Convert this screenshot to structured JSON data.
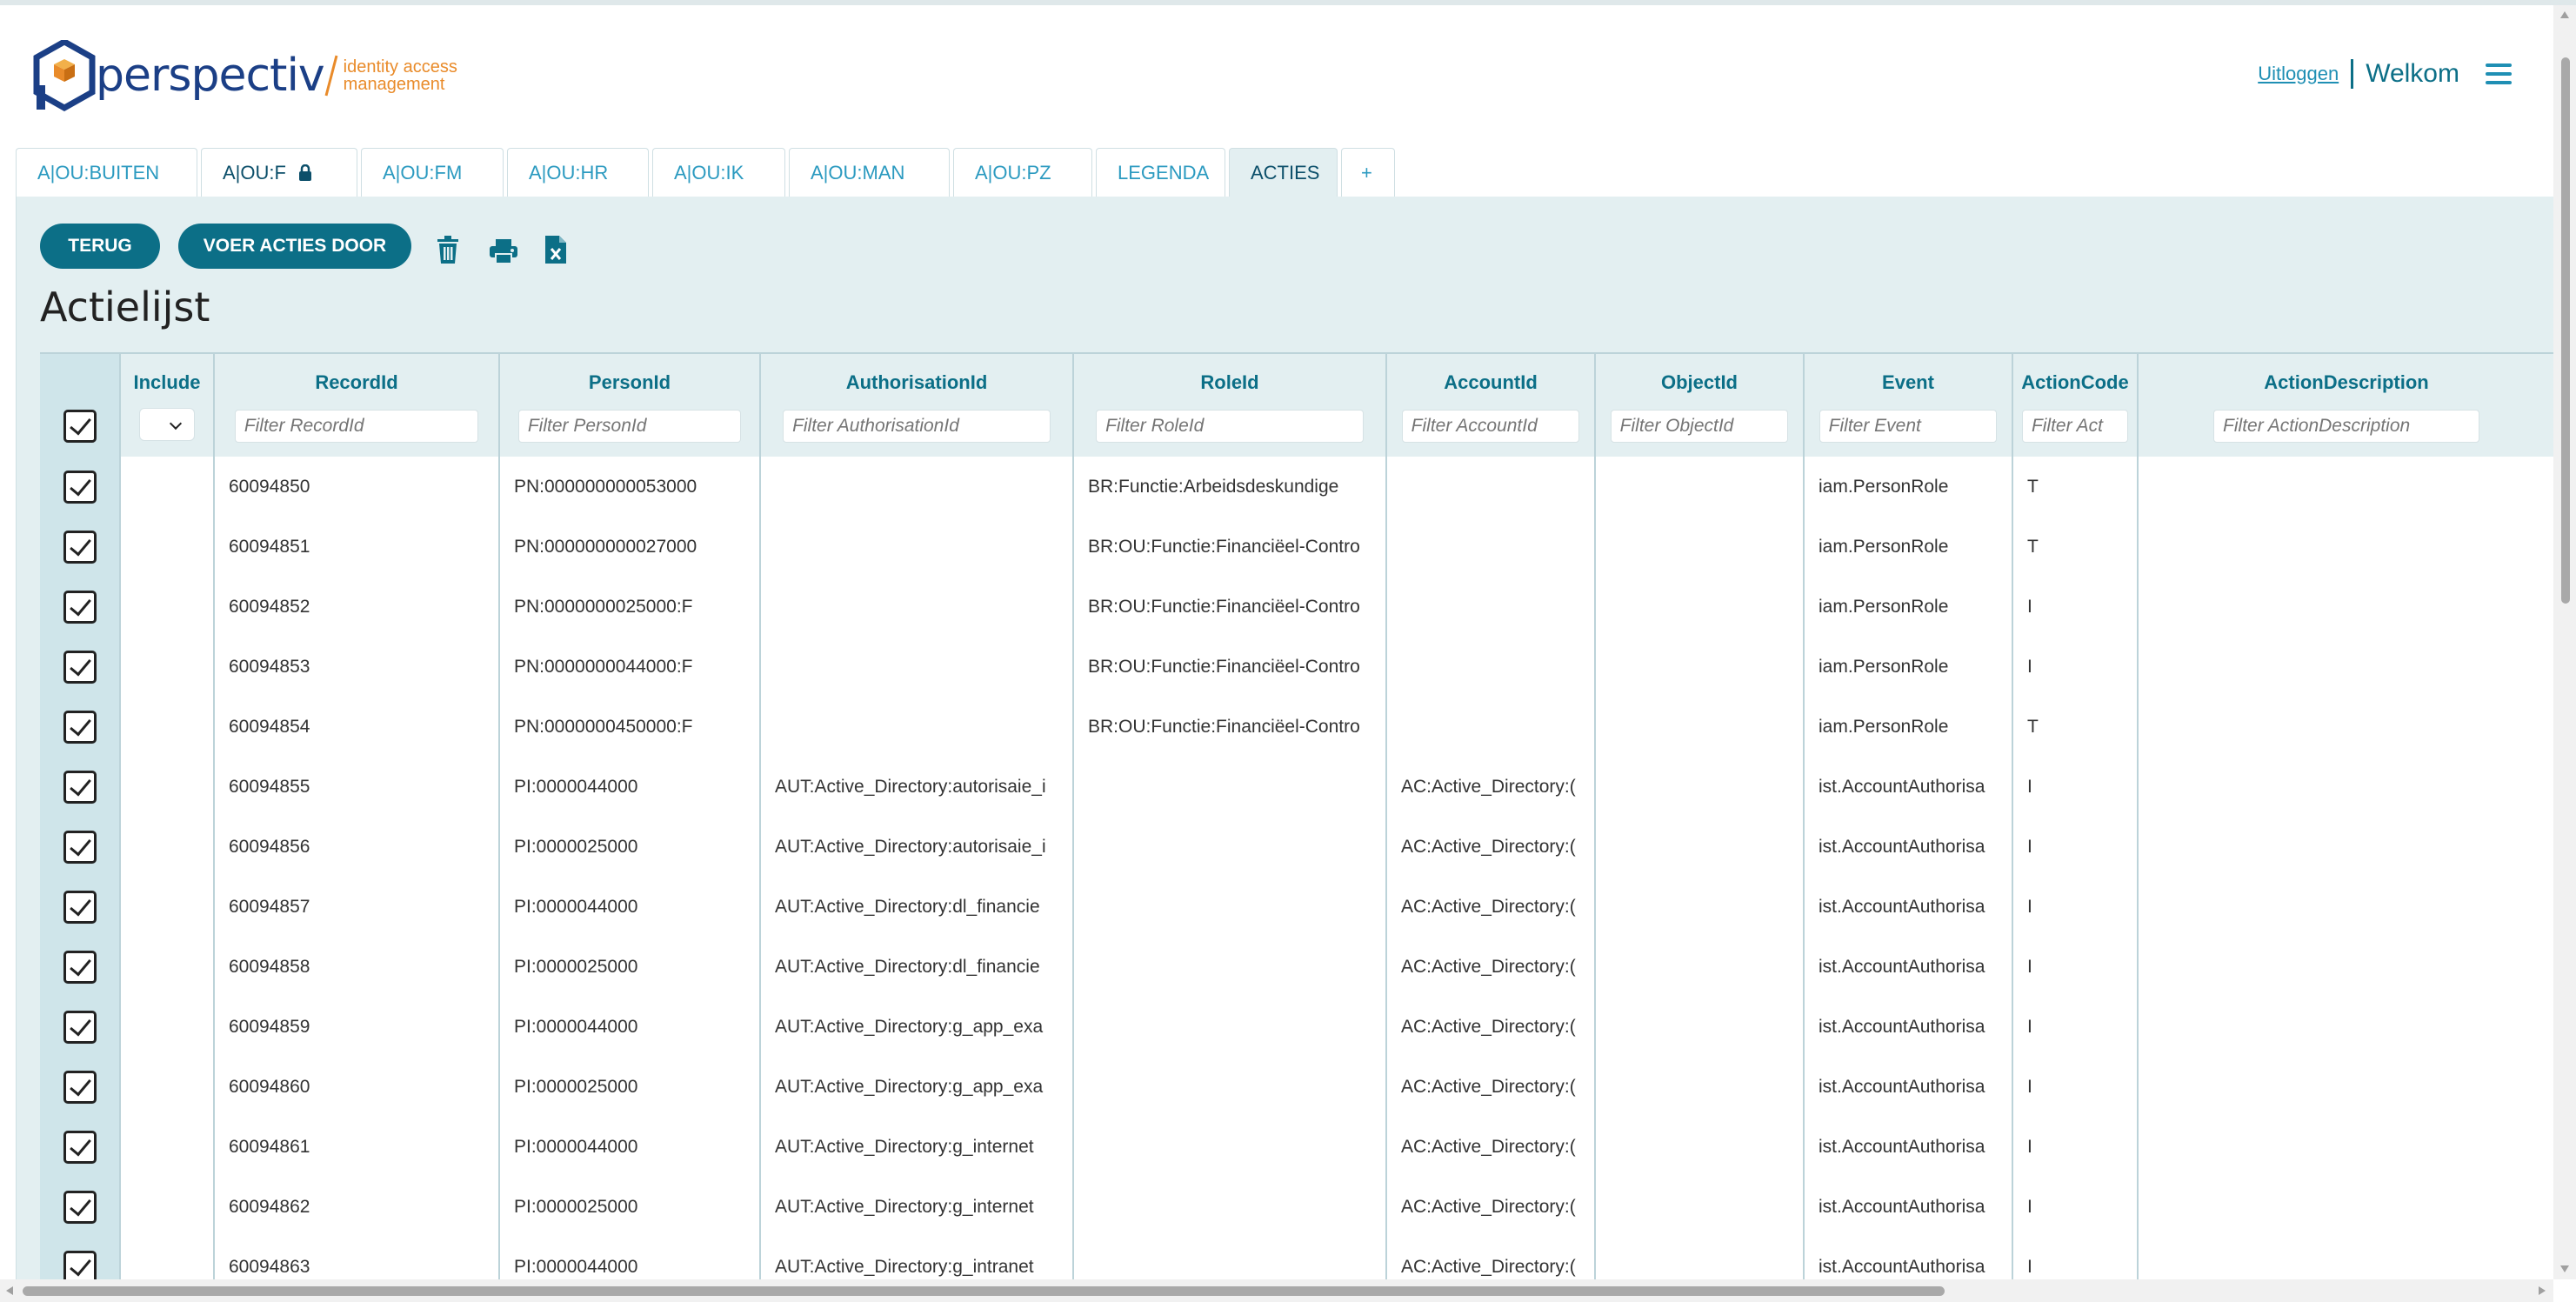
{
  "header": {
    "logo_text": "perspectiv",
    "logo_sub_line1": "identity access",
    "logo_sub_line2": "management",
    "logout_label": "Uitloggen",
    "welcome_label": "Welkom",
    "menu_icon": "hamburger-menu-icon"
  },
  "tabs": [
    {
      "label": "A|OU:BUITEN",
      "active": false
    },
    {
      "label": "A|OU:F",
      "active": true,
      "icon": "lock-icon"
    },
    {
      "label": "A|OU:FM",
      "active": false
    },
    {
      "label": "A|OU:HR",
      "active": false
    },
    {
      "label": "A|OU:IK",
      "active": false
    },
    {
      "label": "A|OU:MAN",
      "active": false
    },
    {
      "label": "A|OU:PZ",
      "active": false
    },
    {
      "label": "LEGENDA",
      "active": false
    },
    {
      "label": "ACTIES",
      "active": true
    },
    {
      "label": "+",
      "active": false
    }
  ],
  "toolbar": {
    "back_label": "TERUG",
    "execute_label": "VOER ACTIES DOOR",
    "icons": [
      "trash-icon",
      "print-icon",
      "excel-export-icon"
    ]
  },
  "page_title": "Actielijst",
  "table": {
    "columns": [
      {
        "label": "Include"
      },
      {
        "label": "RecordId",
        "filter": "Filter RecordId"
      },
      {
        "label": "PersonId",
        "filter": "Filter PersonId"
      },
      {
        "label": "AuthorisationId",
        "filter": "Filter AuthorisationId"
      },
      {
        "label": "RoleId",
        "filter": "Filter RoleId"
      },
      {
        "label": "AccountId",
        "filter": "Filter AccountId"
      },
      {
        "label": "ObjectId",
        "filter": "Filter ObjectId"
      },
      {
        "label": "Event",
        "filter": "Filter Event"
      },
      {
        "label": "ActionCode",
        "filter": "Filter Act"
      },
      {
        "label": "ActionDescription",
        "filter": "Filter ActionDescription"
      }
    ],
    "rows": [
      {
        "record": "60094850",
        "person": "PN:000000000053000",
        "auth": "",
        "role": "BR:Functie:Arbeidsdeskundige",
        "account": "",
        "object": "",
        "event": "iam.PersonRole",
        "code": "T",
        "desc": ""
      },
      {
        "record": "60094851",
        "person": "PN:000000000027000",
        "auth": "",
        "role": "BR:OU:Functie:Financiëel-Contro",
        "account": "",
        "object": "",
        "event": "iam.PersonRole",
        "code": "T",
        "desc": ""
      },
      {
        "record": "60094852",
        "person": "PN:0000000025000:F",
        "auth": "",
        "role": "BR:OU:Functie:Financiëel-Contro",
        "account": "",
        "object": "",
        "event": "iam.PersonRole",
        "code": "I",
        "desc": ""
      },
      {
        "record": "60094853",
        "person": "PN:0000000044000:F",
        "auth": "",
        "role": "BR:OU:Functie:Financiëel-Contro",
        "account": "",
        "object": "",
        "event": "iam.PersonRole",
        "code": "I",
        "desc": ""
      },
      {
        "record": "60094854",
        "person": "PN:0000000450000:F",
        "auth": "",
        "role": "BR:OU:Functie:Financiëel-Contro",
        "account": "",
        "object": "",
        "event": "iam.PersonRole",
        "code": "T",
        "desc": ""
      },
      {
        "record": "60094855",
        "person": "PI:0000044000",
        "auth": "AUT:Active_Directory:autorisaie_i",
        "role": "",
        "account": "AC:Active_Directory:(",
        "object": "",
        "event": "ist.AccountAuthorisa",
        "code": "I",
        "desc": ""
      },
      {
        "record": "60094856",
        "person": "PI:0000025000",
        "auth": "AUT:Active_Directory:autorisaie_i",
        "role": "",
        "account": "AC:Active_Directory:(",
        "object": "",
        "event": "ist.AccountAuthorisa",
        "code": "I",
        "desc": ""
      },
      {
        "record": "60094857",
        "person": "PI:0000044000",
        "auth": "AUT:Active_Directory:dl_financie",
        "role": "",
        "account": "AC:Active_Directory:(",
        "object": "",
        "event": "ist.AccountAuthorisa",
        "code": "I",
        "desc": ""
      },
      {
        "record": "60094858",
        "person": "PI:0000025000",
        "auth": "AUT:Active_Directory:dl_financie",
        "role": "",
        "account": "AC:Active_Directory:(",
        "object": "",
        "event": "ist.AccountAuthorisa",
        "code": "I",
        "desc": ""
      },
      {
        "record": "60094859",
        "person": "PI:0000044000",
        "auth": "AUT:Active_Directory:g_app_exa",
        "role": "",
        "account": "AC:Active_Directory:(",
        "object": "",
        "event": "ist.AccountAuthorisa",
        "code": "I",
        "desc": ""
      },
      {
        "record": "60094860",
        "person": "PI:0000025000",
        "auth": "AUT:Active_Directory:g_app_exa",
        "role": "",
        "account": "AC:Active_Directory:(",
        "object": "",
        "event": "ist.AccountAuthorisa",
        "code": "I",
        "desc": ""
      },
      {
        "record": "60094861",
        "person": "PI:0000044000",
        "auth": "AUT:Active_Directory:g_internet",
        "role": "",
        "account": "AC:Active_Directory:(",
        "object": "",
        "event": "ist.AccountAuthorisa",
        "code": "I",
        "desc": ""
      },
      {
        "record": "60094862",
        "person": "PI:0000025000",
        "auth": "AUT:Active_Directory:g_internet",
        "role": "",
        "account": "AC:Active_Directory:(",
        "object": "",
        "event": "ist.AccountAuthorisa",
        "code": "I",
        "desc": ""
      },
      {
        "record": "60094863",
        "person": "PI:0000044000",
        "auth": "AUT:Active_Directory:g_intranet",
        "role": "",
        "account": "AC:Active_Directory:(",
        "object": "",
        "event": "ist.AccountAuthorisa",
        "code": "I",
        "desc": ""
      }
    ]
  },
  "colors": {
    "accent": "#0c6f87",
    "link": "#1f8fb4",
    "panel_bg": "#e3eff1",
    "logo_blue": "#1b3f86",
    "logo_orange": "#e98b2a"
  }
}
